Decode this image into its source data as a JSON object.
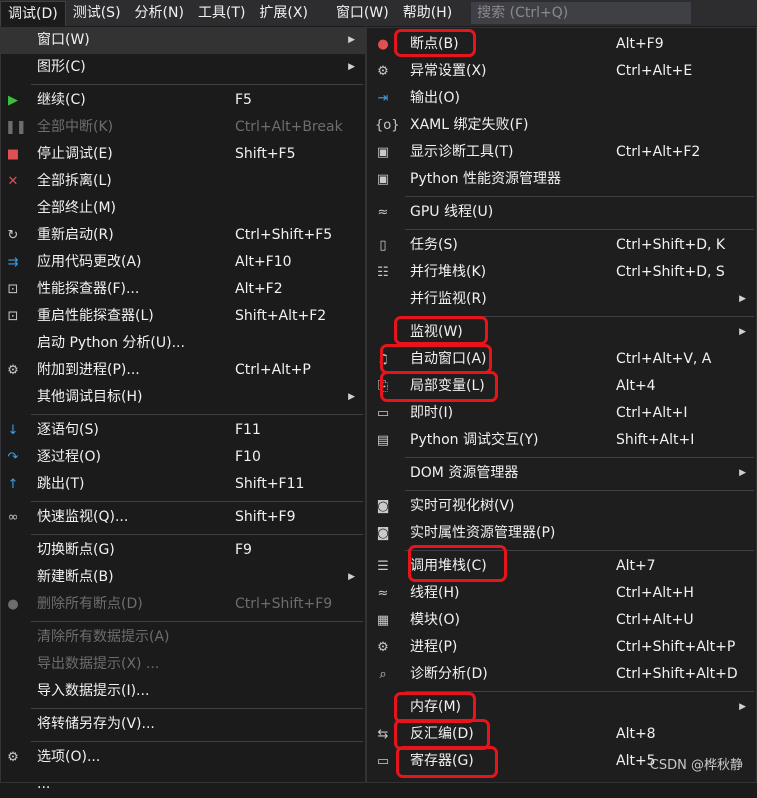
{
  "menubar": {
    "items": [
      {
        "label": "调试(D)",
        "active": true
      },
      {
        "label": "测试(S)"
      },
      {
        "label": "分析(N)"
      },
      {
        "label": "工具(T)"
      },
      {
        "label": "扩展(X)"
      },
      {
        "label": "窗口(W)"
      },
      {
        "label": "帮助(H)"
      }
    ],
    "search_placeholder": "搜索 (Ctrl+Q)"
  },
  "main_menu": [
    {
      "label": "窗口(W)",
      "shortcut": "",
      "arrow": true,
      "icon": "",
      "highlight": true
    },
    {
      "label": "图形(C)",
      "shortcut": "",
      "arrow": true,
      "icon": ""
    },
    {
      "sep": true
    },
    {
      "label": "继续(C)",
      "shortcut": "F5",
      "icon": "play-icon"
    },
    {
      "label": "全部中断(K)",
      "shortcut": "Ctrl+Alt+Break",
      "icon": "pause-icon",
      "disabled": true
    },
    {
      "label": "停止调试(E)",
      "shortcut": "Shift+F5",
      "icon": "stop-icon"
    },
    {
      "label": "全部拆离(L)",
      "shortcut": "",
      "icon": "close-icon"
    },
    {
      "label": "全部终止(M)",
      "shortcut": "",
      "icon": ""
    },
    {
      "label": "重新启动(R)",
      "shortcut": "Ctrl+Shift+F5",
      "icon": "restart-icon"
    },
    {
      "label": "应用代码更改(A)",
      "shortcut": "Alt+F10",
      "icon": "apply-code-icon"
    },
    {
      "label": "性能探查器(F)...",
      "shortcut": "Alt+F2",
      "icon": "profiler-icon"
    },
    {
      "label": "重启性能探查器(L)",
      "shortcut": "Shift+Alt+F2",
      "icon": "profiler-restart-icon"
    },
    {
      "label": "启动 Python 分析(U)...",
      "shortcut": "",
      "icon": ""
    },
    {
      "label": "附加到进程(P)...",
      "shortcut": "Ctrl+Alt+P",
      "icon": "attach-process-icon"
    },
    {
      "label": "其他调试目标(H)",
      "shortcut": "",
      "arrow": true,
      "icon": ""
    },
    {
      "sep": true
    },
    {
      "label": "逐语句(S)",
      "shortcut": "F11",
      "icon": "step-into-icon"
    },
    {
      "label": "逐过程(O)",
      "shortcut": "F10",
      "icon": "step-over-icon"
    },
    {
      "label": "跳出(T)",
      "shortcut": "Shift+F11",
      "icon": "step-out-icon"
    },
    {
      "sep": true
    },
    {
      "label": "快速监视(Q)...",
      "shortcut": "Shift+F9",
      "icon": "glasses-icon"
    },
    {
      "sep": true
    },
    {
      "label": "切换断点(G)",
      "shortcut": "F9",
      "icon": ""
    },
    {
      "label": "新建断点(B)",
      "shortcut": "",
      "arrow": true,
      "icon": ""
    },
    {
      "label": "删除所有断点(D)",
      "shortcut": "Ctrl+Shift+F9",
      "icon": "delete-breakpoints-icon",
      "disabled": true
    },
    {
      "sep": true
    },
    {
      "label": "清除所有数据提示(A)",
      "shortcut": "",
      "icon": "",
      "disabled": true
    },
    {
      "label": "导出数据提示(X) ...",
      "shortcut": "",
      "icon": "",
      "disabled": true
    },
    {
      "label": "导入数据提示(I)...",
      "shortcut": "",
      "icon": ""
    },
    {
      "sep": true
    },
    {
      "label": "将转储另存为(V)...",
      "shortcut": "",
      "icon": ""
    },
    {
      "sep": true
    },
    {
      "label": "选项(O)...",
      "shortcut": "",
      "icon": "gear-icon"
    },
    {
      "label": "...",
      "shortcut": "",
      "icon": ""
    }
  ],
  "sub_menu": [
    {
      "label": "断点(B)",
      "shortcut": "Alt+F9",
      "icon": "breakpoints-icon"
    },
    {
      "label": "异常设置(X)",
      "shortcut": "Ctrl+Alt+E",
      "icon": "exception-settings-icon"
    },
    {
      "label": "输出(O)",
      "shortcut": "",
      "icon": "output-icon"
    },
    {
      "label": "XAML 绑定失败(F)",
      "shortcut": "",
      "icon": "xaml-icon"
    },
    {
      "label": "显示诊断工具(T)",
      "shortcut": "Ctrl+Alt+F2",
      "icon": "diagnostic-tools-icon"
    },
    {
      "label": "Python 性能资源管理器",
      "shortcut": "",
      "icon": "python-profiler-icon"
    },
    {
      "sep": true
    },
    {
      "label": "GPU 线程(U)",
      "shortcut": "",
      "icon": "gpu-threads-icon"
    },
    {
      "sep": true
    },
    {
      "label": "任务(S)",
      "shortcut": "Ctrl+Shift+D, K",
      "icon": "tasks-icon"
    },
    {
      "label": "并行堆栈(K)",
      "shortcut": "Ctrl+Shift+D, S",
      "icon": "parallel-stacks-icon"
    },
    {
      "label": "并行监视(R)",
      "shortcut": "",
      "arrow": true,
      "icon": ""
    },
    {
      "sep": true
    },
    {
      "label": "监视(W)",
      "shortcut": "",
      "arrow": true,
      "icon": ""
    },
    {
      "label": "自动窗口(A)",
      "shortcut": "Ctrl+Alt+V, A",
      "icon": "autos-icon"
    },
    {
      "label": "局部变量(L)",
      "shortcut": "Alt+4",
      "icon": "locals-icon"
    },
    {
      "label": "即时(I)",
      "shortcut": "Ctrl+Alt+I",
      "icon": "immediate-icon"
    },
    {
      "label": "Python 调试交互(Y)",
      "shortcut": "Shift+Alt+I",
      "icon": "python-interactive-icon"
    },
    {
      "sep": true
    },
    {
      "label": "DOM 资源管理器",
      "shortcut": "",
      "arrow": true,
      "icon": ""
    },
    {
      "sep": true
    },
    {
      "label": "实时可视化树(V)",
      "shortcut": "",
      "icon": "camera-icon"
    },
    {
      "label": "实时属性资源管理器(P)",
      "shortcut": "",
      "icon": "camera-icon"
    },
    {
      "sep": true
    },
    {
      "label": "调用堆栈(C)",
      "shortcut": "Alt+7",
      "icon": "call-stack-icon"
    },
    {
      "label": "线程(H)",
      "shortcut": "Ctrl+Alt+H",
      "icon": "threads-icon"
    },
    {
      "label": "模块(O)",
      "shortcut": "Ctrl+Alt+U",
      "icon": "modules-icon"
    },
    {
      "label": "进程(P)",
      "shortcut": "Ctrl+Shift+Alt+P",
      "icon": "processes-icon"
    },
    {
      "label": "诊断分析(D)",
      "shortcut": "Ctrl+Shift+Alt+D",
      "icon": "diagnostic-analysis-icon"
    },
    {
      "sep": true
    },
    {
      "label": "内存(M)",
      "shortcut": "",
      "arrow": true,
      "icon": ""
    },
    {
      "label": "反汇编(D)",
      "shortcut": "Alt+8",
      "icon": "disassembly-icon"
    },
    {
      "label": "寄存器(G)",
      "shortcut": "Alt+5",
      "icon": "registers-icon"
    }
  ],
  "watermark": "CSDN @桦秋静",
  "colors": {
    "highlight_box": "#e8141c",
    "menu_bg": "#1b1b1c",
    "menubar_bg": "#2d2d30"
  }
}
